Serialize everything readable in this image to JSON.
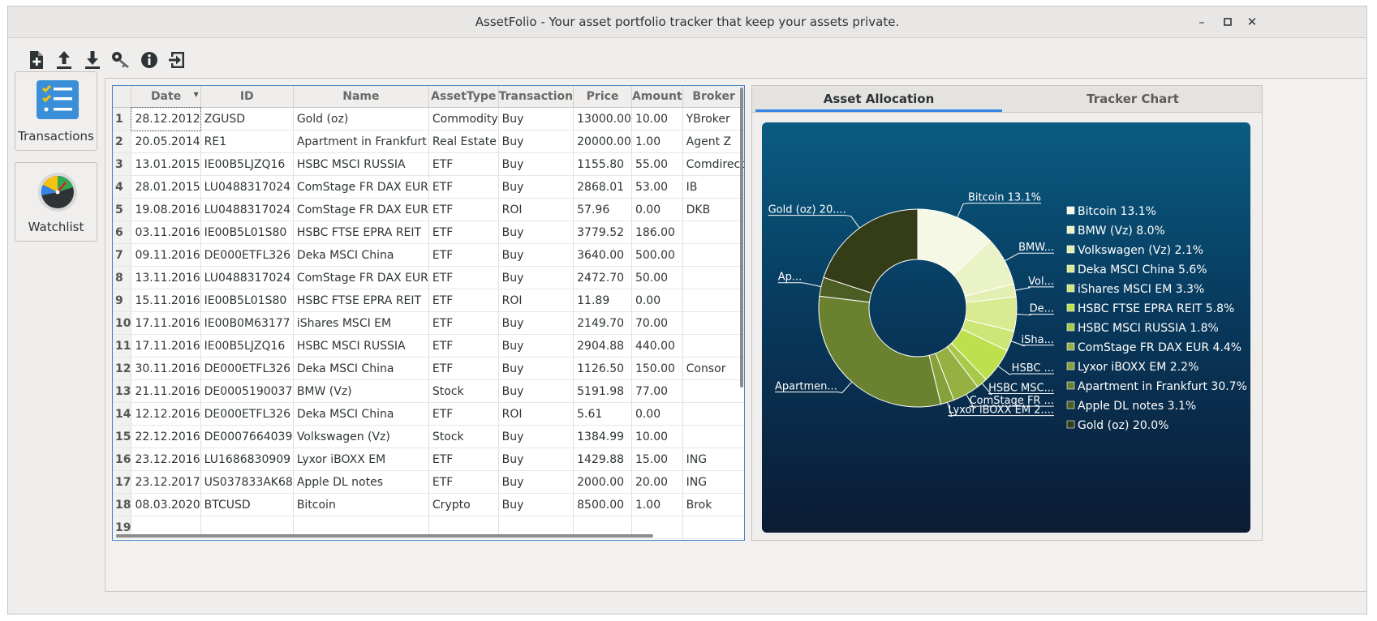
{
  "window": {
    "title": "AssetFolio - Your asset portfolio tracker that keep your assets private.",
    "minimize": "–",
    "maximize": "▫",
    "close": "✕"
  },
  "toolbar": {
    "icons": [
      "new-file-icon",
      "upload-icon",
      "download-icon",
      "key-icon",
      "info-icon",
      "exit-icon"
    ]
  },
  "sidebar": {
    "items": [
      {
        "label": "Transactions",
        "icon": "checklist-icon"
      },
      {
        "label": "Watchlist",
        "icon": "gauge-icon"
      }
    ]
  },
  "table": {
    "columns": [
      "Date",
      "ID",
      "Name",
      "AssetType",
      "Transaction",
      "Price",
      "Amount",
      "Broker"
    ],
    "sort_indicator": "▾",
    "rows": [
      [
        "1",
        "28.12.2012",
        "ZGUSD",
        "Gold (oz)",
        "Commodity",
        "Buy",
        "13000.00",
        "10.00",
        "YBroker"
      ],
      [
        "2",
        "20.05.2014",
        "RE1",
        "Apartment in Frankfurt",
        "Real Estate",
        "Buy",
        "20000.00",
        "1.00",
        "Agent Z"
      ],
      [
        "3",
        "13.01.2015",
        "IE00B5LJZQ16",
        "HSBC MSCI RUSSIA",
        "ETF",
        "Buy",
        "1155.80",
        "55.00",
        "Comdirect"
      ],
      [
        "4",
        "28.01.2015",
        "LU0488317024",
        "ComStage FR DAX EUR",
        "ETF",
        "Buy",
        "2868.01",
        "53.00",
        "IB"
      ],
      [
        "5",
        "19.08.2016",
        "LU0488317024",
        "ComStage FR DAX EUR",
        "ETF",
        "ROI",
        "57.96",
        "0.00",
        "DKB"
      ],
      [
        "6",
        "03.11.2016",
        "IE00B5L01S80",
        "HSBC FTSE EPRA REIT",
        "ETF",
        "Buy",
        "3779.52",
        "186.00",
        ""
      ],
      [
        "7",
        "09.11.2016",
        "DE000ETFL326",
        "Deka MSCI China",
        "ETF",
        "Buy",
        "3640.00",
        "500.00",
        ""
      ],
      [
        "8",
        "13.11.2016",
        "LU0488317024",
        "ComStage FR DAX EUR",
        "ETF",
        "Buy",
        "2472.70",
        "50.00",
        ""
      ],
      [
        "9",
        "15.11.2016",
        "IE00B5L01S80",
        "HSBC FTSE EPRA REIT",
        "ETF",
        "ROI",
        "11.89",
        "0.00",
        ""
      ],
      [
        "10",
        "17.11.2016",
        "IE00B0M63177",
        "iShares MSCI EM",
        "ETF",
        "Buy",
        "2149.70",
        "70.00",
        ""
      ],
      [
        "11",
        "17.11.2016",
        "IE00B5LJZQ16",
        "HSBC MSCI RUSSIA",
        "ETF",
        "Buy",
        "2904.88",
        "440.00",
        ""
      ],
      [
        "12",
        "30.11.2016",
        "DE000ETFL326",
        "Deka MSCI China",
        "ETF",
        "Buy",
        "1126.50",
        "150.00",
        "Consor"
      ],
      [
        "13",
        "21.11.2016",
        "DE0005190037",
        "BMW (Vz)",
        "Stock",
        "Buy",
        "5191.98",
        "77.00",
        ""
      ],
      [
        "14",
        "12.12.2016",
        "DE000ETFL326",
        "Deka MSCI China",
        "ETF",
        "ROI",
        "5.61",
        "0.00",
        ""
      ],
      [
        "15",
        "22.12.2016",
        "DE0007664039",
        "Volkswagen (Vz)",
        "Stock",
        "Buy",
        "1384.99",
        "10.00",
        ""
      ],
      [
        "16",
        "23.12.2016",
        "LU1686830909",
        "Lyxor iBOXX EM",
        "ETF",
        "Buy",
        "1429.88",
        "15.00",
        "ING"
      ],
      [
        "17",
        "23.12.2017",
        "US037833AK68",
        "Apple DL notes",
        "ETF",
        "Buy",
        "2000.00",
        "20.00",
        "ING"
      ],
      [
        "18",
        "08.03.2020",
        "BTCUSD",
        "Bitcoin",
        "Crypto",
        "Buy",
        "8500.00",
        "1.00",
        "Brok"
      ],
      [
        "19",
        "",
        "",
        "",
        "",
        "",
        "",
        "",
        ""
      ]
    ]
  },
  "tabs": [
    {
      "label": "Asset Allocation",
      "active": true
    },
    {
      "label": "Tracker Chart",
      "active": false
    }
  ],
  "chart_data": {
    "type": "pie",
    "slices": [
      {
        "name": "Bitcoin",
        "value": 13.1,
        "legend": "Bitcoin 13.1%",
        "label": "Bitcoin 13.1%",
        "color": "#f4f8e4"
      },
      {
        "name": "BMW (Vz)",
        "value": 8.0,
        "legend": "BMW (Vz) 8.0%",
        "label": "BMW...",
        "color": "#eaf2c8"
      },
      {
        "name": "Volkswagen (Vz)",
        "value": 2.1,
        "legend": "Volkswagen (Vz) 2.1%",
        "label": "Vol...",
        "color": "#e3efb2"
      },
      {
        "name": "Deka MSCI China",
        "value": 5.6,
        "legend": "Deka MSCI China 5.6%",
        "label": "De...",
        "color": "#d8eb92"
      },
      {
        "name": "iShares MSCI EM",
        "value": 3.3,
        "legend": "iShares MSCI EM 3.3%",
        "label": "iSha...",
        "color": "#cde678"
      },
      {
        "name": "HSBC FTSE EPRA REIT",
        "value": 5.8,
        "legend": "HSBC FTSE EPRA REIT 5.8%",
        "label": "HSBC ...",
        "color": "#bfe04e"
      },
      {
        "name": "HSBC MSCI RUSSIA",
        "value": 1.8,
        "legend": "HSBC MSCI RUSSIA 1.8%",
        "label": "HSBC MSC...",
        "color": "#a8c84a"
      },
      {
        "name": "ComStage FR DAX EUR",
        "value": 4.4,
        "legend": "ComStage FR DAX EUR 4.4%",
        "label": "ComStage FR ...",
        "color": "#96b042"
      },
      {
        "name": "Lyxor iBOXX EM",
        "value": 2.2,
        "legend": "Lyxor iBOXX EM 2.2%",
        "label": "Lyxor iBOXX EM 2....",
        "color": "#86a03a"
      },
      {
        "name": "Apartment in Frankfurt",
        "value": 30.7,
        "legend": "Apartment in Frankfurt 30.7%",
        "label": "Apartmen...",
        "color": "#6a8230"
      },
      {
        "name": "Apple DL notes",
        "value": 3.1,
        "legend": "Apple DL notes 3.1%",
        "label": "Ap...",
        "color": "#4d5e24"
      },
      {
        "name": "Gold (oz)",
        "value": 20.0,
        "legend": "Gold (oz) 20.0%",
        "label": "Gold (oz) 20....",
        "color": "#343c18"
      }
    ]
  }
}
